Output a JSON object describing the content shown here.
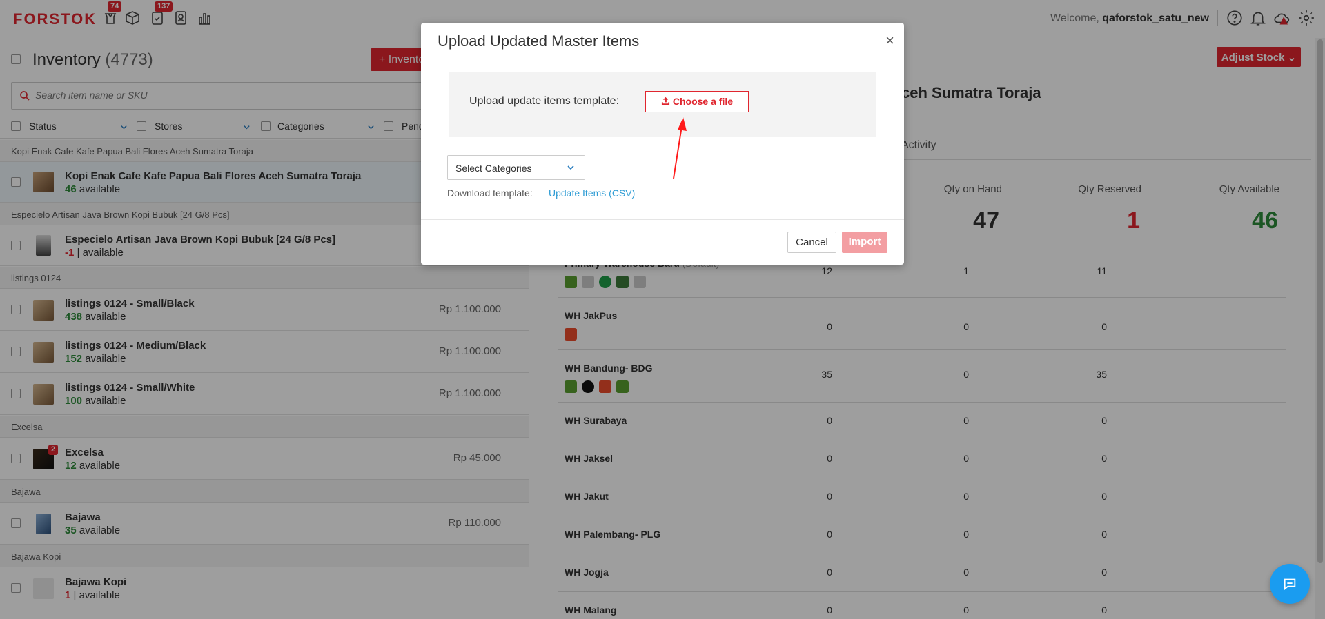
{
  "app": {
    "logo": "FORSTOK"
  },
  "nav": {
    "badges": {
      "orders": "74",
      "tasks": "137"
    },
    "welcome_prefix": "Welcome,",
    "username": "qaforstok_satu_new"
  },
  "inventory": {
    "title": "Inventory",
    "count": "(4773)",
    "add_button": "+ Inventory",
    "search_placeholder": "Search item name or SKU",
    "filters": [
      "Status",
      "Stores",
      "Categories",
      "Pending"
    ]
  },
  "list": [
    {
      "group": "Kopi Enak Cafe Kafe Papua Bali Flores Aceh Sumatra Toraja",
      "name": "Kopi Enak Cafe Kafe Papua Bali Flores Aceh Sumatra Toraja",
      "qty": "46",
      "suffix": "available",
      "price": "",
      "negative": false
    },
    {
      "group": "Especielo Artisan Java Brown Kopi Bubuk [24 G/8 Pcs]",
      "name": "Especielo Artisan Java Brown Kopi Bubuk [24 G/8 Pcs]",
      "qty": "-1",
      "suffix": "| available",
      "price": "",
      "negative": true
    },
    {
      "group": "listings 0124",
      "name": "listings 0124 - Small/Black",
      "qty": "438",
      "suffix": "available",
      "price": "Rp 1.100.000",
      "negative": false
    },
    {
      "group": "",
      "name": "listings 0124 - Medium/Black",
      "qty": "152",
      "suffix": "available",
      "price": "Rp 1.100.000",
      "negative": false
    },
    {
      "group": "",
      "name": "listings 0124 - Small/White",
      "qty": "100",
      "suffix": "available",
      "price": "Rp 1.100.000",
      "negative": false
    },
    {
      "group": "Excelsa",
      "name": "Excelsa",
      "qty": "12",
      "suffix": "available",
      "price": "Rp 45.000",
      "negative": false,
      "thumb_badge": "2"
    },
    {
      "group": "Bajawa",
      "name": "Bajawa",
      "qty": "35",
      "suffix": "available",
      "price": "Rp 110.000",
      "negative": false
    },
    {
      "group": "Bajawa Kopi",
      "name": "Bajawa Kopi",
      "qty": "1",
      "suffix": "| available",
      "price": "",
      "negative": true
    }
  ],
  "detail": {
    "title_tail": "ceh Sumatra Toraja",
    "tab_activity": "Activity",
    "adjust_button": "Adjust Stock",
    "headers": {
      "on_hand": "Qty on Hand",
      "reserved": "Qty Reserved",
      "available": "Qty Available"
    },
    "totals": {
      "on_hand": "47",
      "reserved": "1",
      "available": "46"
    },
    "warehouses": [
      {
        "name": "Primary Warehouse Baru",
        "tag": "(Default)",
        "on_hand": "12",
        "reserved": "1",
        "available": "11"
      },
      {
        "name": "WH JakPus",
        "on_hand": "0",
        "reserved": "0",
        "available": "0"
      },
      {
        "name": "WH Bandung- BDG",
        "on_hand": "35",
        "reserved": "0",
        "available": "35"
      },
      {
        "name": "WH Surabaya",
        "on_hand": "0",
        "reserved": "0",
        "available": "0"
      },
      {
        "name": "WH Jaksel",
        "on_hand": "0",
        "reserved": "0",
        "available": "0"
      },
      {
        "name": "WH Jakut",
        "on_hand": "0",
        "reserved": "0",
        "available": "0"
      },
      {
        "name": "WH Palembang- PLG",
        "on_hand": "0",
        "reserved": "0",
        "available": "0"
      },
      {
        "name": "WH Jogja",
        "on_hand": "0",
        "reserved": "0",
        "available": "0"
      },
      {
        "name": "WH Malang",
        "on_hand": "0",
        "reserved": "0",
        "available": "0"
      }
    ]
  },
  "modal": {
    "title": "Upload Updated Master Items",
    "close": "×",
    "upload_label": "Upload update items template:",
    "choose_file": "Choose a file",
    "select_categories": "Select Categories",
    "download_label": "Download template:",
    "download_link": "Update Items (CSV)",
    "cancel": "Cancel",
    "import": "Import"
  },
  "colors": {
    "brand": "#e0262f",
    "available": "#2e8b3a",
    "link": "#2c9bd4",
    "chat": "#1a9cf0"
  }
}
